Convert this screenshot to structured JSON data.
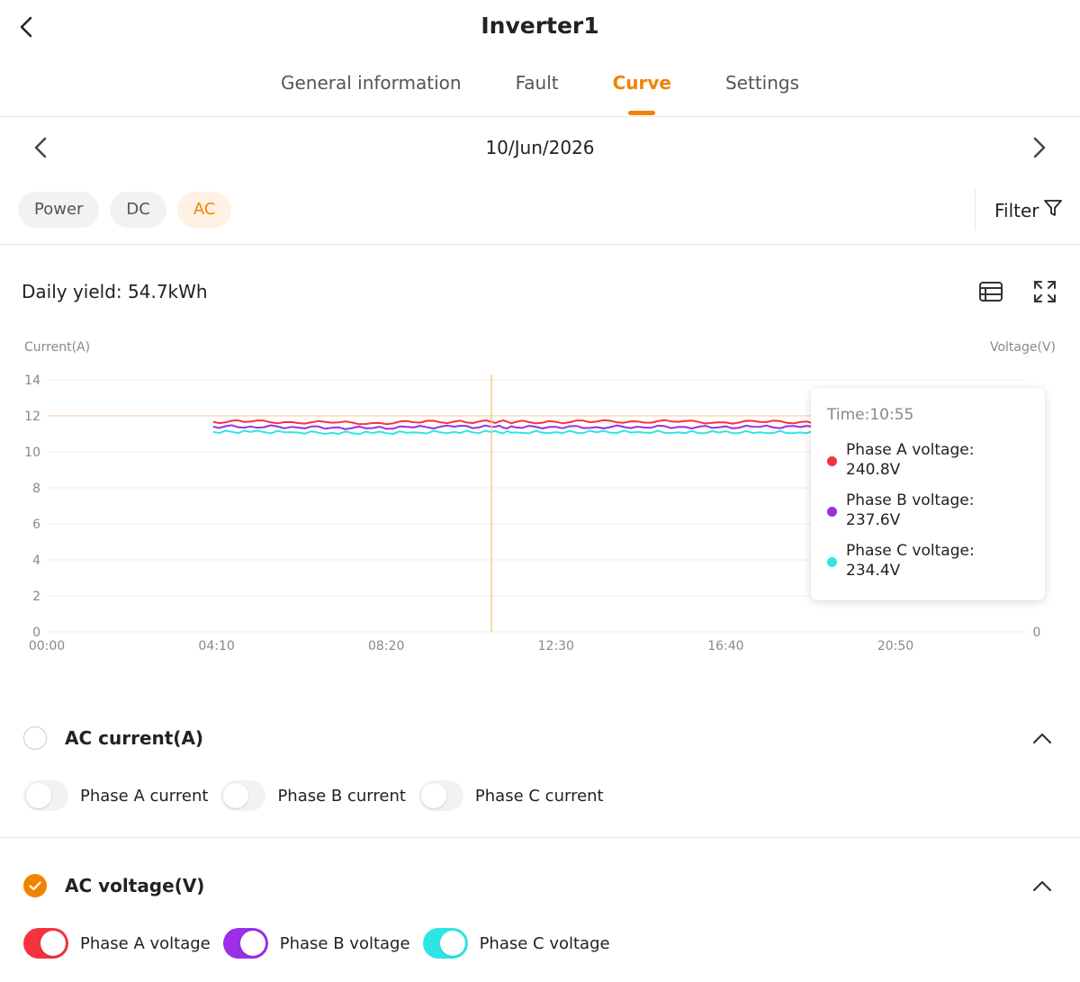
{
  "header": {
    "title": "Inverter1",
    "tabs": [
      {
        "label": "General information",
        "active": false
      },
      {
        "label": "Fault",
        "active": false
      },
      {
        "label": "Curve",
        "active": true
      },
      {
        "label": "Settings",
        "active": false
      }
    ]
  },
  "date": {
    "label": "10/Jun/2026"
  },
  "chips": [
    {
      "label": "Power",
      "active": false
    },
    {
      "label": "DC",
      "active": false
    },
    {
      "label": "AC",
      "active": true
    }
  ],
  "filter": {
    "label": "Filter"
  },
  "summary": {
    "daily_yield": "Daily yield: 54.7kWh"
  },
  "colors": {
    "accent": "#f08300",
    "phase_a": "#f5333f",
    "phase_b": "#9b2ee6",
    "phase_c": "#2ee5e5"
  },
  "chart_data": {
    "type": "line",
    "ylabel_left": "Current(A)",
    "ylabel_right": "Voltage(V)",
    "x_ticks": [
      "00:00",
      "04:10",
      "08:20",
      "12:30",
      "16:40",
      "20:50"
    ],
    "y_left_ticks": [
      "0",
      "2",
      "4",
      "6",
      "8",
      "10",
      "12",
      "14"
    ],
    "y_left_range": [
      0,
      14
    ],
    "y_right_visible_ticks": [
      "0"
    ],
    "x_range_minutes": [
      0,
      1440
    ],
    "grid": true,
    "cursor_time": "10:55",
    "series": [
      {
        "name": "Phase A voltage",
        "color": "#f5333f",
        "x": [
          "04:05",
          "05:00",
          "06:00",
          "07:00",
          "08:00",
          "09:00",
          "10:00",
          "10:55",
          "11:30",
          "12:30",
          "13:30",
          "14:30",
          "15:30",
          "16:30",
          "17:30",
          "18:30",
          "19:25"
        ],
        "y": [
          240.8,
          240.9,
          240.6,
          240.2,
          240.0,
          240.5,
          240.9,
          240.8,
          240.6,
          240.7,
          240.9,
          241.0,
          240.8,
          240.5,
          240.7,
          240.6,
          240.4
        ]
      },
      {
        "name": "Phase B voltage",
        "color": "#9b2ee6",
        "x": [
          "04:05",
          "05:00",
          "06:00",
          "07:00",
          "08:00",
          "09:00",
          "10:00",
          "10:55",
          "11:30",
          "12:30",
          "13:30",
          "14:30",
          "15:30",
          "16:30",
          "17:30",
          "18:30",
          "19:25"
        ],
        "y": [
          237.8,
          237.9,
          237.6,
          237.1,
          236.9,
          237.3,
          237.7,
          237.6,
          237.4,
          237.6,
          237.5,
          237.8,
          237.6,
          237.4,
          237.6,
          237.5,
          237.3
        ]
      },
      {
        "name": "Phase C voltage",
        "color": "#2ee5e5",
        "x": [
          "04:05",
          "05:00",
          "06:00",
          "07:00",
          "08:00",
          "09:00",
          "10:00",
          "10:55",
          "11:30",
          "12:30",
          "13:30",
          "14:30",
          "15:30",
          "16:30",
          "17:30",
          "18:30",
          "19:25"
        ],
        "y": [
          234.6,
          234.5,
          234.3,
          234.0,
          233.8,
          234.2,
          234.5,
          234.4,
          234.2,
          234.4,
          234.3,
          234.5,
          234.3,
          234.1,
          234.3,
          234.2,
          234.0
        ]
      }
    ],
    "reference_line": {
      "color": "#fde3c8",
      "y_left": 12
    }
  },
  "tooltip": {
    "time": "Time:10:55",
    "items": [
      {
        "label": "Phase A voltage:",
        "value": "240.8V",
        "color": "#f5333f"
      },
      {
        "label": "Phase B voltage:",
        "value": "237.6V",
        "color": "#9b2ee6"
      },
      {
        "label": "Phase C voltage:",
        "value": "234.4V",
        "color": "#2ee5e5"
      }
    ]
  },
  "groups": [
    {
      "title": "AC current(A)",
      "checked": false,
      "toggles": [
        {
          "label": "Phase A current",
          "on": false,
          "color": "#f2f2f2"
        },
        {
          "label": "Phase B current",
          "on": false,
          "color": "#f2f2f2"
        },
        {
          "label": "Phase C current",
          "on": false,
          "color": "#f2f2f2"
        }
      ]
    },
    {
      "title": "AC voltage(V)",
      "checked": true,
      "toggles": [
        {
          "label": "Phase A voltage",
          "on": true,
          "color": "#f5333f"
        },
        {
          "label": "Phase B voltage",
          "on": true,
          "color": "#9b2ee6"
        },
        {
          "label": "Phase C voltage",
          "on": true,
          "color": "#2ee5e5"
        }
      ]
    }
  ]
}
